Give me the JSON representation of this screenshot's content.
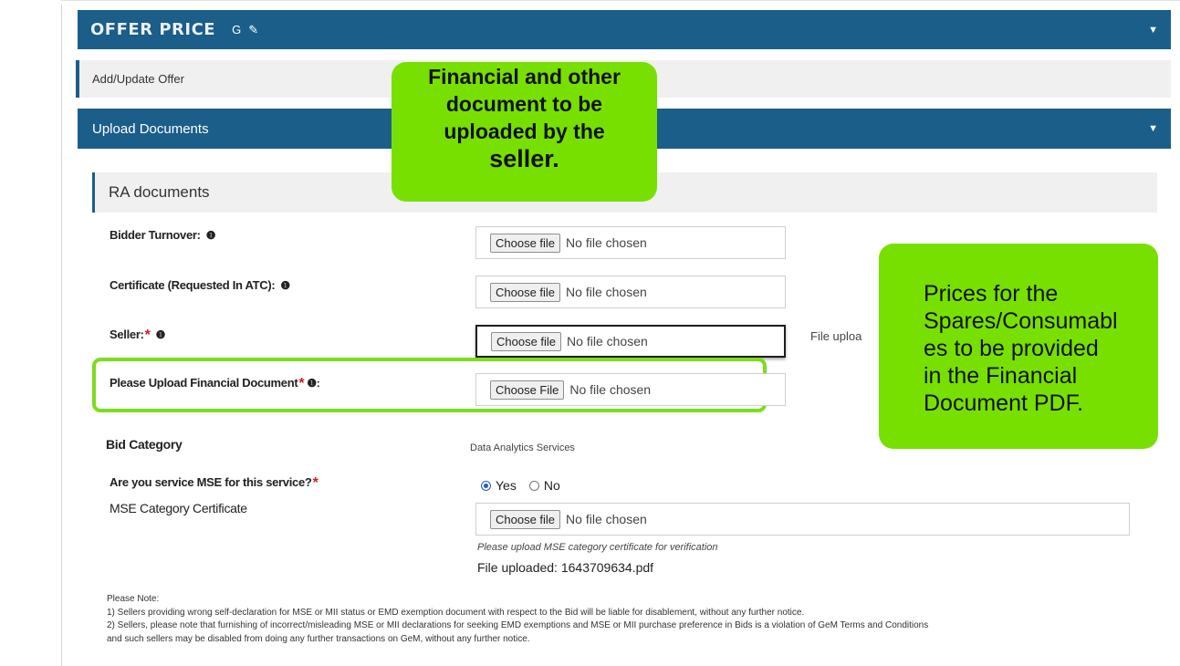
{
  "offer_bar": {
    "title": "OFFER PRICE",
    "g_label": "G",
    "edit_icon": "edit-icon",
    "caret": "▼"
  },
  "add_update": {
    "label": "Add/Update Offer"
  },
  "upload_bar": {
    "title": "Upload Documents",
    "caret": "▼"
  },
  "ra_section": {
    "title": "RA documents"
  },
  "fields": [
    {
      "label": "Bidder Turnover:",
      "button": "Choose file",
      "status": "No file chosen"
    },
    {
      "label": "Certificate (Requested In ATC):",
      "button": "Choose file",
      "status": "No file chosen"
    },
    {
      "label": "Seller:",
      "button": "Choose file",
      "status": "No file chosen",
      "side_text": "File uploa"
    },
    {
      "label": "Please Upload Financial Document",
      "button": "Choose File",
      "status": "No file chosen"
    }
  ],
  "bid_category": {
    "label": "Bid Category",
    "value": "Data Analytics Services"
  },
  "mse": {
    "question": "Are you service MSE for this service?",
    "yes": "Yes",
    "no": "No",
    "selected": "Yes",
    "cert_label": "MSE Category Certificate",
    "button": "Choose file",
    "status": "No file chosen",
    "hint": "Please upload MSE category certificate for verification",
    "uploaded": "File uploaded: 1643709634.pdf"
  },
  "notes": {
    "heading": "Please Note:",
    "line1": "1) Sellers providing wrong self-declaration for MSE or MII status or EMD exemption document with respect to the Bid will be liable for disablement, without any further notice.",
    "line2": "2) Sellers, please note that furnishing of incorrect/misleading MSE or MII declarations for seeking EMD exemptions and MSE or MII purchase preference in Bids is a violation of GeM Terms and Conditions",
    "line3": "and such sellers may be disabled from doing any further transactions on GeM, without any further notice."
  },
  "callouts": {
    "top": [
      "Financial and other",
      "document to be",
      "uploaded by the",
      "seller."
    ],
    "right": [
      "Prices for the",
      "Spares/Consumabl",
      "es to be provided",
      "in the Financial",
      "Document PDF."
    ]
  },
  "colors": {
    "bar": "#1b5e8a",
    "callout": "#78e000",
    "outline": "#7ddc1f",
    "required": "#d21c1c"
  }
}
